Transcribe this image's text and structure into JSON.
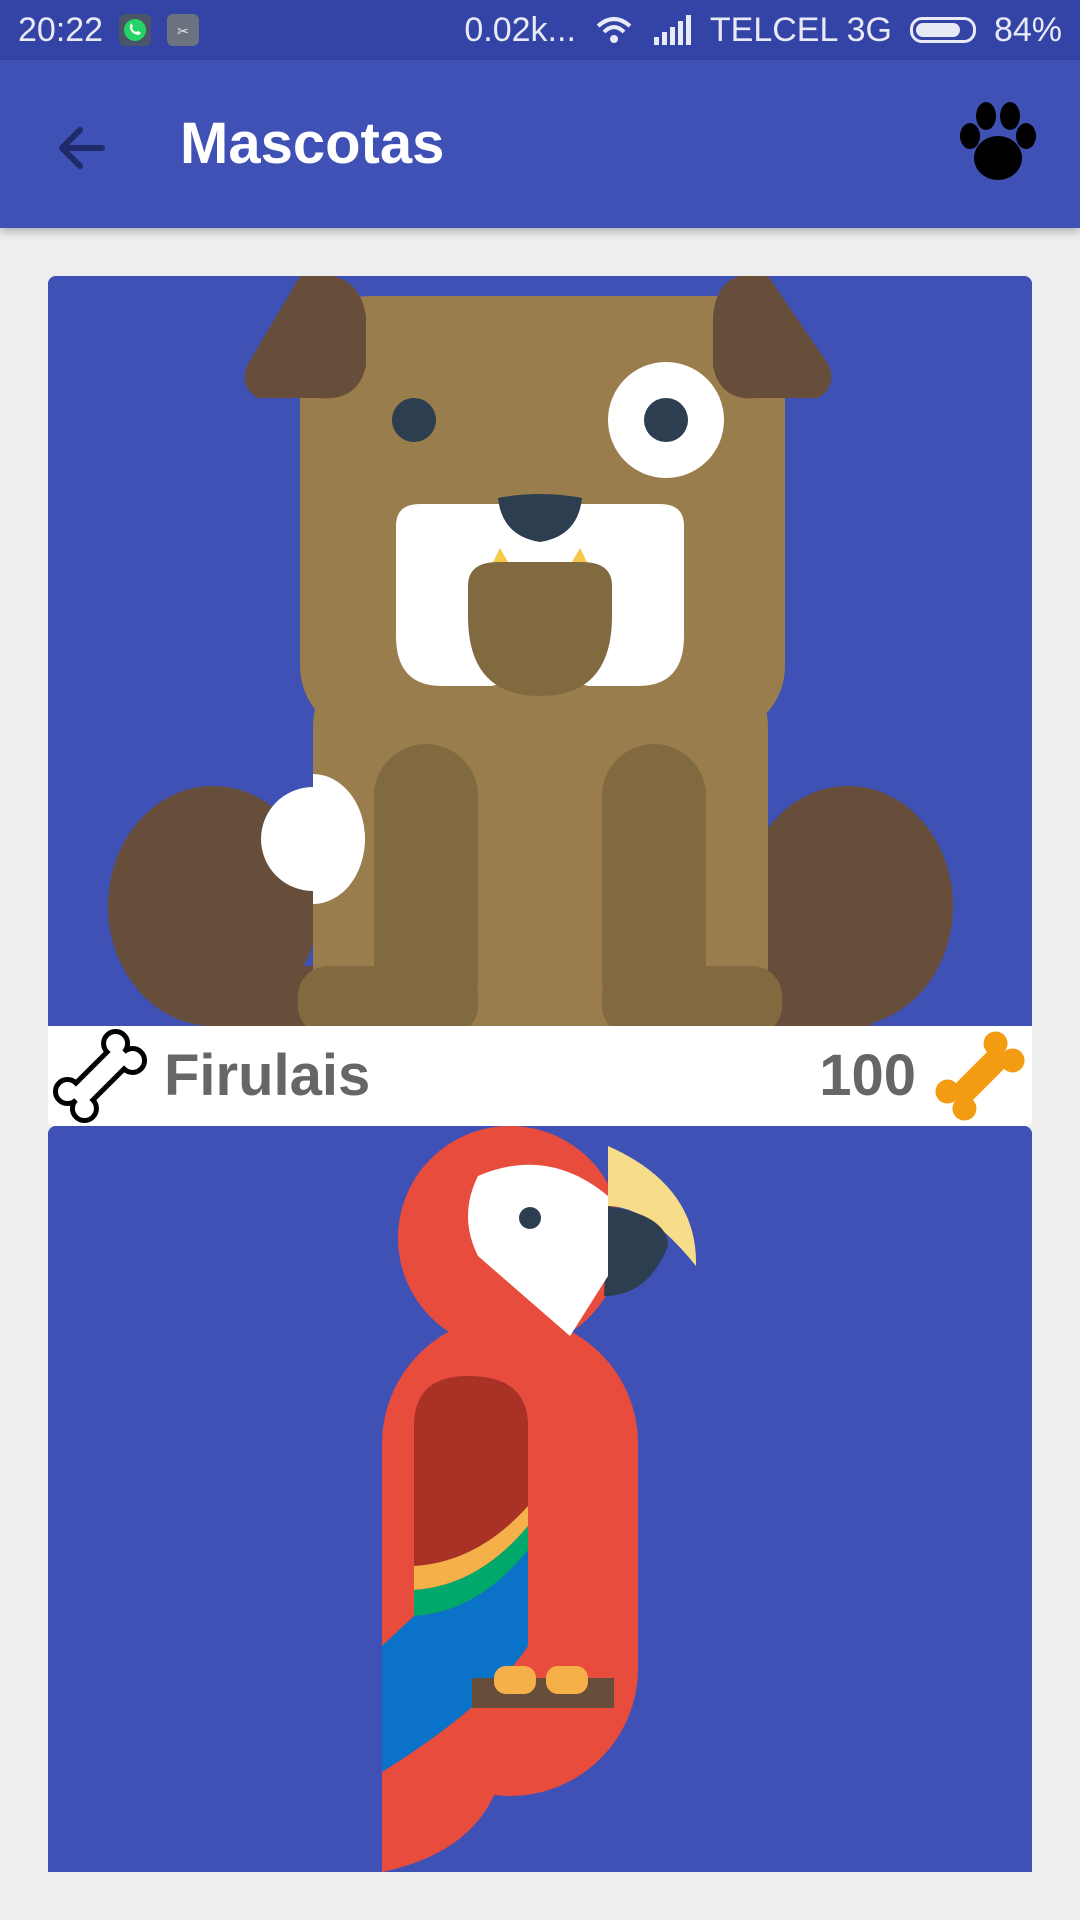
{
  "status_bar": {
    "time": "20:22",
    "data_rate": "0.02k...",
    "carrier": "TELCEL 3G",
    "battery": "84%",
    "battery_level": 0.84,
    "icons": [
      "whatsapp-icon",
      "app-icon",
      "wifi-icon",
      "signal-icon",
      "battery-icon"
    ]
  },
  "app_bar": {
    "title": "Mascotas",
    "back_icon": "arrow-back-icon",
    "action_icon": "paw-icon",
    "color": "#3f51b5"
  },
  "pets": [
    {
      "name": "Firulais",
      "rating": "100",
      "image": "dog",
      "like_icon": "bone-outline-icon",
      "rating_icon": "bone-icon",
      "rating_icon_color": "#f39c12"
    },
    {
      "image": "parrot"
    }
  ]
}
